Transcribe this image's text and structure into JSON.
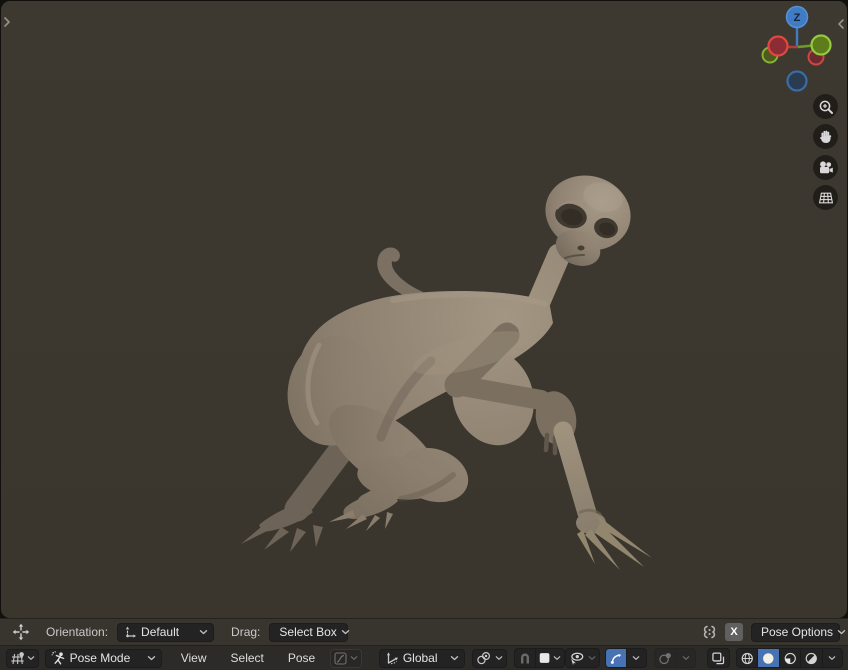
{
  "viewport": {
    "name": "3D Viewport (Pose Mode)",
    "gizmo": {
      "z_label": "Z"
    },
    "nav_buttons": [
      {
        "name": "zoom"
      },
      {
        "name": "pan"
      },
      {
        "name": "camera-view"
      },
      {
        "name": "toggle-orthographic"
      }
    ]
  },
  "tool_settings": {
    "orientation_label": "Orientation:",
    "orientation_value": "Default",
    "drag_label": "Drag:",
    "drag_value": "Select Box",
    "mirror_x_label": "X",
    "pose_options_label": "Pose Options"
  },
  "header": {
    "mode": {
      "label": "Pose Mode"
    },
    "menus": [
      {
        "label": "View"
      },
      {
        "label": "Select"
      },
      {
        "label": "Pose"
      }
    ],
    "transform_orientation": {
      "label": "Global"
    }
  },
  "icons": {
    "chevron-down-icon": "v",
    "move-tool-icon": "four-way arrows",
    "orientation-axes-icon": "axis arrows",
    "mirror-x-icon": "mirrored halves",
    "editor-type-icon": "3d viewport grid with sphere",
    "pose-mode-icon": "stick figure with sparkle",
    "proportional-falloff-icon": "falloff curve",
    "global-orientation-icon": "axis with rotation arrow",
    "pivot-point-icon": "two circles with dot",
    "snap-magnet-icon": "magnet",
    "snap-target-icon": "white square",
    "visibility-eye-icon": "eye with cursor",
    "gizmo-toggle-icon": "arc arrow",
    "overlays-icon": "two spheres",
    "xray-toggle-icon": "overlapping squares",
    "wireframe-shading-icon": "wire sphere",
    "solid-shading-icon": "white sphere",
    "material-shading-icon": "sphere with quarter",
    "rendered-shading-icon": "shaded sphere"
  },
  "colors": {
    "viewport_bg": "#3b372f",
    "tool_settings_bg": "#38352f",
    "header_bg": "#2d2b27",
    "widget_bg": "#232323",
    "accent_selected": "#4772b3",
    "axis_x": "#d9453d",
    "axis_y": "#84b52e",
    "axis_z": "#3f7cc4",
    "model_clay": "#8c7f6f",
    "text": "#e0e0e0"
  }
}
